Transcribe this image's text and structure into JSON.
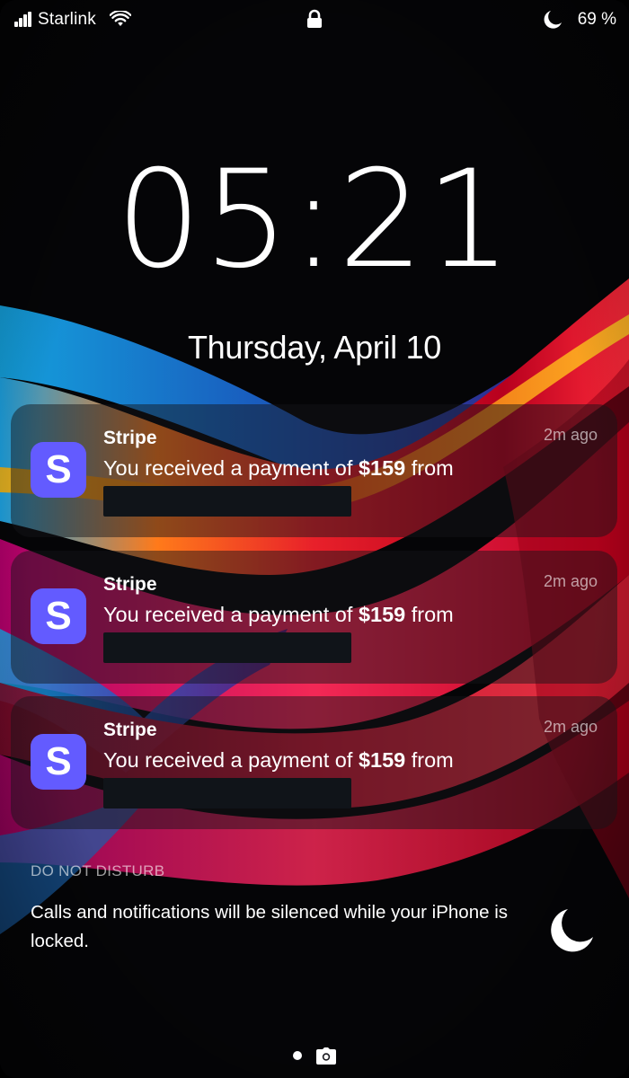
{
  "status_bar": {
    "carrier": "Starlink",
    "battery": "69 %"
  },
  "lock_screen": {
    "time": "05:21",
    "date": "Thursday, April 10"
  },
  "notifications": [
    {
      "app_icon_letter": "S",
      "app_name": "Stripe",
      "time_ago": "2m ago",
      "message_prefix": "You received a payment of ",
      "amount": "$159",
      "message_suffix": " from"
    },
    {
      "app_icon_letter": "S",
      "app_name": "Stripe",
      "time_ago": "2m ago",
      "message_prefix": "You received a payment of ",
      "amount": "$159",
      "message_suffix": " from"
    },
    {
      "app_icon_letter": "S",
      "app_name": "Stripe",
      "time_ago": "2m ago",
      "message_prefix": "You received a payment of ",
      "amount": "$159",
      "message_suffix": " from"
    }
  ],
  "do_not_disturb": {
    "title": "DO NOT DISTURB",
    "text": "Calls and notifications will be silenced while your iPhone is locked.",
    "icon": "moon-icon"
  },
  "icons": {
    "signal": "cellular-signal-icon",
    "wifi": "wifi-icon",
    "lock": "lock-icon",
    "focus": "moon-icon",
    "camera": "camera-icon"
  },
  "colors": {
    "stripe_brand": "#635bff",
    "redaction": "#101419"
  }
}
